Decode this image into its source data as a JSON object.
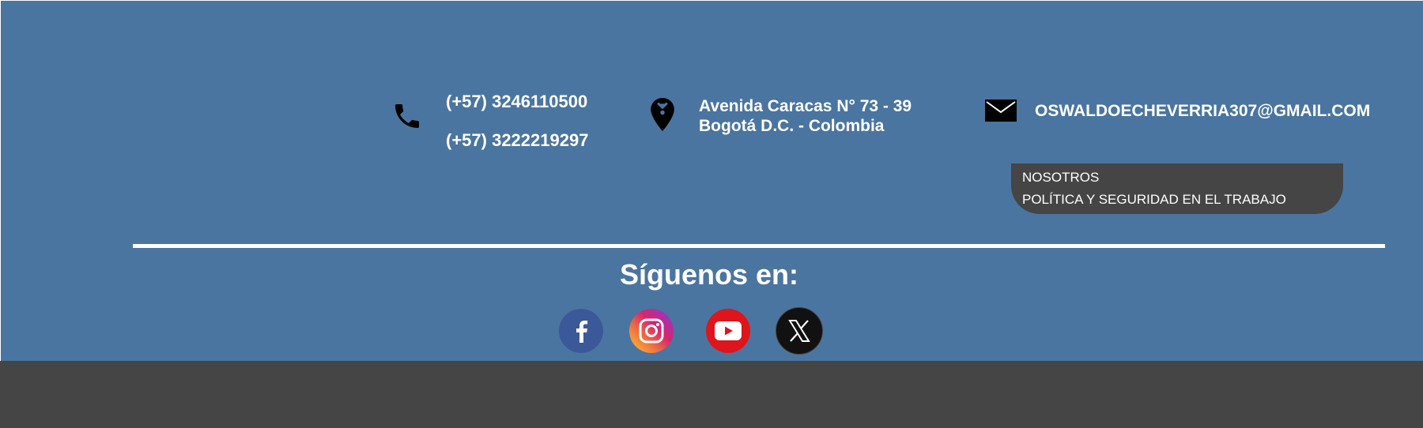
{
  "contact": {
    "phones": [
      "(+57) 3246110500",
      "(+57) 3222219297"
    ],
    "address_line1": "Avenida Caracas N° 73 - 39",
    "address_line2": "Bogotá D.C. - Colombia",
    "email": "OSWALDOECHEVERRIA307@GMAIL.COM"
  },
  "menu": {
    "items": [
      {
        "label": "NOSOTROS"
      },
      {
        "label": "POLÍTICA Y SEGURIDAD EN EL TRABAJO"
      }
    ]
  },
  "social": {
    "heading": "Síguenos en:",
    "links": [
      {
        "icon": "facebook-icon",
        "color": "#3b5998"
      },
      {
        "icon": "instagram-icon",
        "color": "#d8246d"
      },
      {
        "icon": "youtube-icon",
        "color": "#e0141b"
      },
      {
        "icon": "x-icon",
        "color": "#111111"
      }
    ]
  },
  "colors": {
    "footer_background": "#4a75a0",
    "bottom_bar": "#454545",
    "menu_background": "#454545",
    "text": "#ffffff"
  }
}
